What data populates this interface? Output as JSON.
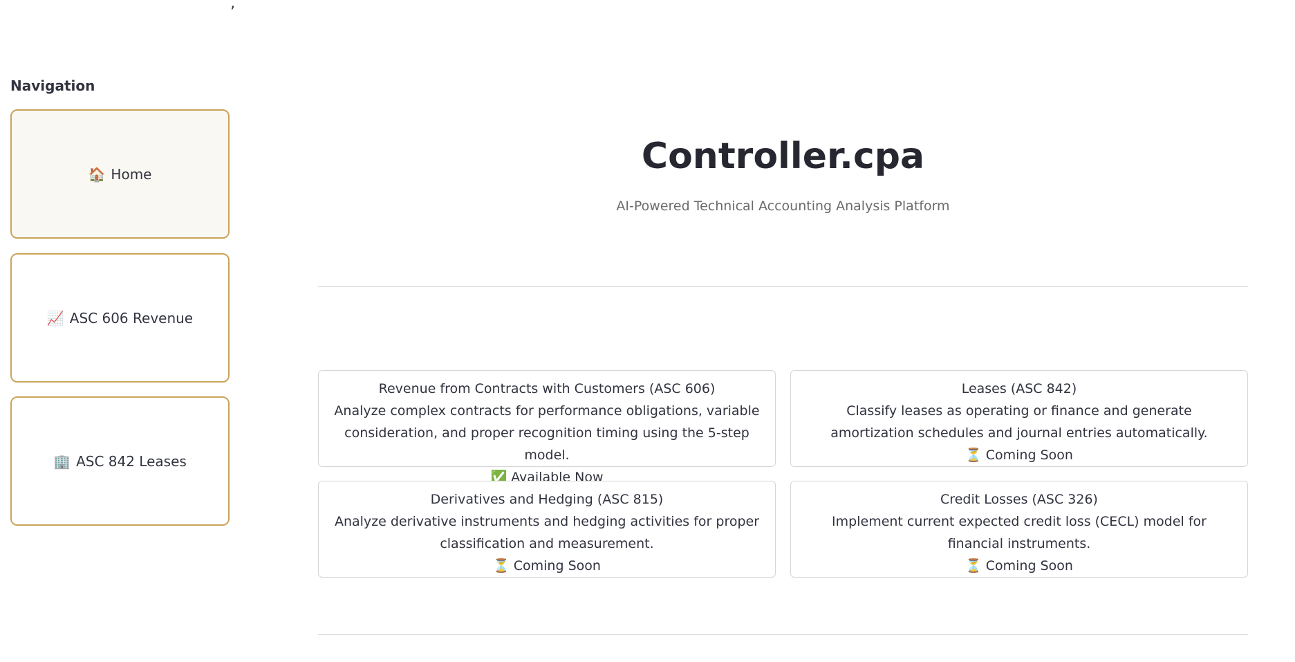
{
  "stray_mark": "’",
  "sidebar": {
    "title": "Navigation",
    "items": [
      {
        "icon": "🏠",
        "icon_name": "home-icon",
        "label": "Home",
        "active": true
      },
      {
        "icon": "📈",
        "icon_name": "chart-increasing-icon",
        "label": "ASC 606 Revenue",
        "active": false
      },
      {
        "icon": "🏢",
        "icon_name": "office-building-icon",
        "label": "ASC 842 Leases",
        "active": false
      }
    ]
  },
  "hero": {
    "title": "Controller.cpa",
    "subtitle": "AI-Powered Technical Accounting Analysis Platform"
  },
  "cards": [
    {
      "title": "Revenue from Contracts with Customers (ASC 606)",
      "description": "Analyze complex contracts for performance obligations, variable consideration, and proper recognition timing using the 5-step model.",
      "status_icon": "✅",
      "status_icon_name": "check-mark-icon",
      "status": "Available Now"
    },
    {
      "title": "Leases (ASC 842)",
      "description": "Classify leases as operating or finance and generate amortization schedules and journal entries automatically.",
      "status_icon": "⏳",
      "status_icon_name": "hourglass-icon",
      "status": "Coming Soon"
    },
    {
      "title": "Derivatives and Hedging (ASC 815)",
      "description": "Analyze derivative instruments and hedging activities for proper classification and measurement.",
      "status_icon": "⏳",
      "status_icon_name": "hourglass-icon",
      "status": "Coming Soon"
    },
    {
      "title": "Credit Losses (ASC 326)",
      "description": "Implement current expected credit loss (CECL) model for financial instruments.",
      "status_icon": "⏳",
      "status_icon_name": "hourglass-icon",
      "status": "Coming Soon"
    }
  ],
  "colors": {
    "nav_border": "#c9a45b",
    "nav_active_bg": "#faf8f3",
    "text": "#31333f",
    "subtitle": "#6b6b6b",
    "card_border": "#d6d6d6",
    "divider": "#d9d9d9"
  }
}
